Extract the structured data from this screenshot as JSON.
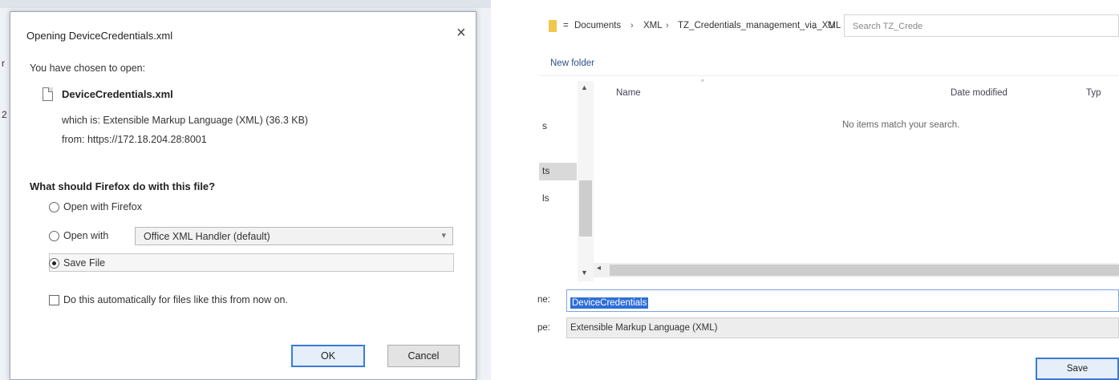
{
  "download_dialog": {
    "title": "Opening DeviceCredentials.xml",
    "close_glyph": "×",
    "chosen_text": "You have chosen to open:",
    "file_name": "DeviceCredentials.xml",
    "which_is": "which is: Extensible Markup Language (XML) (36.3 KB)",
    "from": "from: https://172.18.204.28:8001",
    "question": "What should Firefox do with this file?",
    "open_with_firefox_label": "Open with Firefox",
    "open_with_label": "Open with",
    "handler_value": "Office XML Handler (default)",
    "save_file_label": "Save File",
    "auto_label": "Do this automatically for files like this from now on.",
    "ok_label": "OK",
    "cancel_label": "Cancel",
    "selected_option": "save_file"
  },
  "background_fragments": [
    "r",
    "2"
  ],
  "save_dialog": {
    "breadcrumb": [
      "Documents",
      "XML",
      "TZ_Credentials_management_via_XML"
    ],
    "breadcrumb_prefix": "=",
    "search_placeholder": "Search TZ_Crede",
    "new_folder_label": "New folder",
    "nav_fragments": [
      "s",
      "ts",
      "ls"
    ],
    "columns": {
      "name": "Name",
      "date": "Date modified",
      "type": "Typ"
    },
    "empty_message": "No items match your search.",
    "file_name_label": "ne:",
    "file_name_value": "DeviceCredentials",
    "save_type_label": "pe:",
    "save_type_value": "Extensible Markup Language (XML)",
    "save_label": "Save"
  },
  "colors": {
    "accent": "#2e6ed8",
    "button_border": "#3b7ad6",
    "folder": "#f0c74a"
  }
}
